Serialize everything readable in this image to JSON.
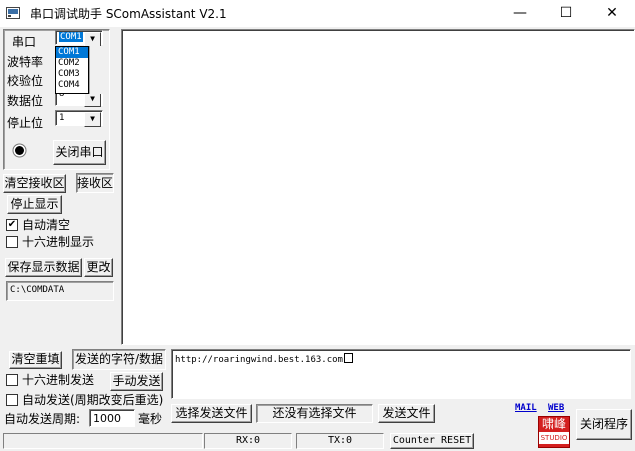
{
  "window": {
    "title": "串口调试助手 SComAssistant V2.1",
    "minimize": "—",
    "maximize": "☐",
    "close": "✕"
  },
  "settings": {
    "port_label": "串口",
    "port_value": "COM1",
    "port_options": [
      "COM1",
      "COM2",
      "COM3",
      "COM4"
    ],
    "baud_label": "波特率",
    "parity_label": "校验位",
    "databits_label": "数据位",
    "databits_value": "8",
    "stopbits_label": "停止位",
    "stopbits_value": "1",
    "close_port_button": "关闭串口"
  },
  "receive": {
    "clear_button": "清空接收区",
    "area_label": "接收区",
    "stop_display_button": "停止显示",
    "auto_clear_label": "自动清空",
    "auto_clear_checked": true,
    "hex_display_label": "十六进制显示",
    "hex_display_checked": false,
    "save_data_button": "保存显示数据",
    "change_button": "更改",
    "save_path": "C:\\COMDATA",
    "content": ""
  },
  "send": {
    "clear_resend_button": "清空重填",
    "send_chars_label": "发送的字符/数据",
    "hex_send_label": "十六进制发送",
    "manual_send_button": "手动发送",
    "auto_send_label": "自动发送(周期改变后重选)",
    "period_label": "自动发送周期:",
    "period_value": "1000",
    "period_unit": "毫秒",
    "content": "http://roaringwind.best.163.com",
    "select_file_button": "选择发送文件",
    "file_status": "还没有选择文件",
    "send_file_button": "发送文件"
  },
  "links": {
    "mail": "MAIL",
    "web": "WEB"
  },
  "logo": {
    "line1": "啸峰",
    "line2": "STUDIO"
  },
  "close_program_button": "关闭程序",
  "status": {
    "rx": "RX:0",
    "tx": "TX:0",
    "counter_reset": "Counter RESET"
  },
  "colors": {
    "window_bg": "#f0f0f0",
    "link": "#0000cc",
    "logo_bg": "#d42020",
    "selection": "#0078d7"
  }
}
